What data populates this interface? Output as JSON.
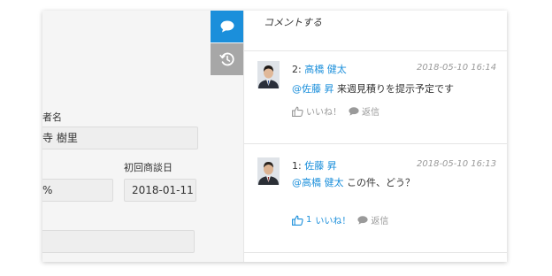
{
  "form": {
    "label1": "者名",
    "value1": "寺 樹里",
    "label2": "初回商談日",
    "value2": "%",
    "value3": "2018-01-11",
    "value4": ""
  },
  "colors": {
    "accent": "#1b8fdb",
    "tab_inactive": "#a7a7a7"
  },
  "panel": {
    "header": "コメントする",
    "comments": [
      {
        "num": "2:",
        "author": "高橋 健太",
        "time": "2018-05-10 16:14",
        "mention": "@佐藤 昇",
        "text": "来週見積りを提示予定です",
        "like_count": "",
        "like_label": "いいね！",
        "reply_label": "返信"
      },
      {
        "num": "1:",
        "author": "佐藤 昇",
        "time": "2018-05-10 16:13",
        "mention": "@高橋 健太",
        "text": "この件、どう？",
        "like_count": "1",
        "like_label": "いいね！",
        "reply_label": "返信"
      }
    ]
  },
  "icons": {
    "comment_tab": "speech-bubble-icon",
    "history_tab": "clock-history-icon",
    "like": "thumbs-up-icon",
    "reply": "speech-bubble-icon"
  }
}
